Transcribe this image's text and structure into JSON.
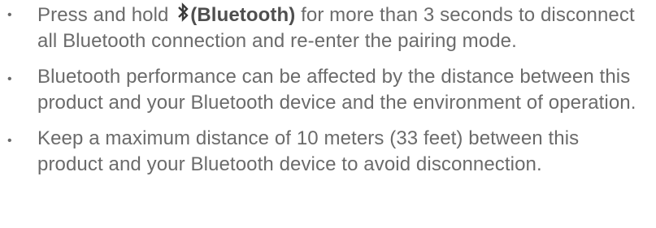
{
  "bullets": [
    {
      "before": "Press and hold ",
      "icon": "bluetooth-icon",
      "bold": "(Bluetooth)",
      "after": " for more than 3 seconds to disconnect all Bluetooth connection and re-enter the pairing mode."
    },
    {
      "text": "Bluetooth performance can be affected by the distance between this product and your Bluetooth device and the environment of operation."
    },
    {
      "text": "Keep a maximum distance of 10 meters (33 feet) between this product and your Bluetooth device to avoid disconnection."
    }
  ],
  "bullet_glyph": "•"
}
